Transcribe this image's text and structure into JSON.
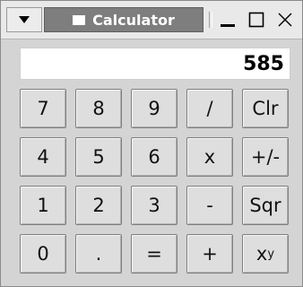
{
  "window": {
    "title": "Calculator",
    "menu_icon": "triangle-down-icon",
    "minimize_icon": "minimize-icon",
    "maximize_icon": "maximize-icon",
    "close_icon": "close-icon"
  },
  "display": {
    "value": "585"
  },
  "keys": {
    "row1": [
      "7",
      "8",
      "9",
      "/",
      "Clr"
    ],
    "row2": [
      "4",
      "5",
      "6",
      "x",
      "+/-"
    ],
    "row3": [
      "1",
      "2",
      "3",
      "-",
      "Sqr"
    ],
    "row4": [
      "0",
      ".",
      "=",
      "+",
      "x"
    ],
    "power_superscript": "y"
  },
  "colors": {
    "window_bg": "#d4d4d4",
    "title_tab_bg": "#7e7e7e",
    "display_bg": "#ffffff",
    "key_bg": "#dedede"
  }
}
